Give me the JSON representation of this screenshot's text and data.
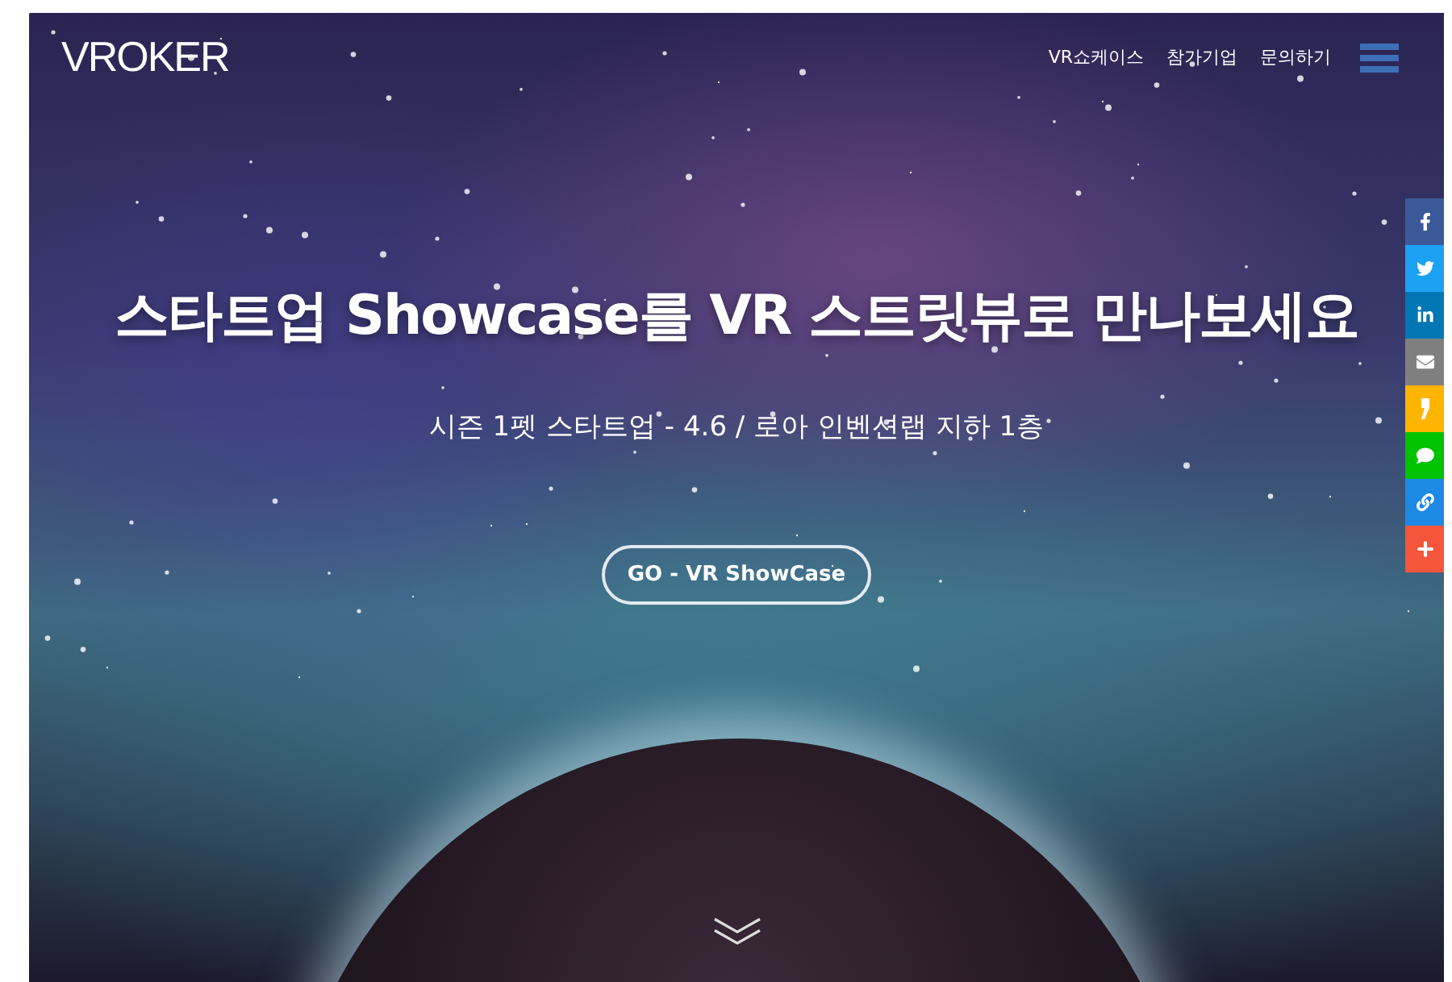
{
  "header": {
    "logo": "VROKER",
    "nav": [
      {
        "label": "VR쇼케이스"
      },
      {
        "label": "참가기업"
      },
      {
        "label": "문의하기"
      }
    ]
  },
  "hero": {
    "title": "스타트업 Showcase를 VR 스트릿뷰로 만나보세요",
    "subtitle": "시즌 1펫 스타트업 - 4.6 / 로아 인벤션랩 지하 1층",
    "button": "GO - VR ShowCase"
  },
  "share_buttons": [
    {
      "kind": "facebook",
      "color": "#3b5998"
    },
    {
      "kind": "twitter",
      "color": "#1da1f2"
    },
    {
      "kind": "linkedin",
      "color": "#0077b5"
    },
    {
      "kind": "mail",
      "color": "#7f7f7f"
    },
    {
      "kind": "comma",
      "color": "#ffb400"
    },
    {
      "kind": "chat",
      "color": "#00c300"
    },
    {
      "kind": "link",
      "color": "#1e88e5"
    },
    {
      "kind": "plus",
      "color": "#f4553b"
    }
  ]
}
